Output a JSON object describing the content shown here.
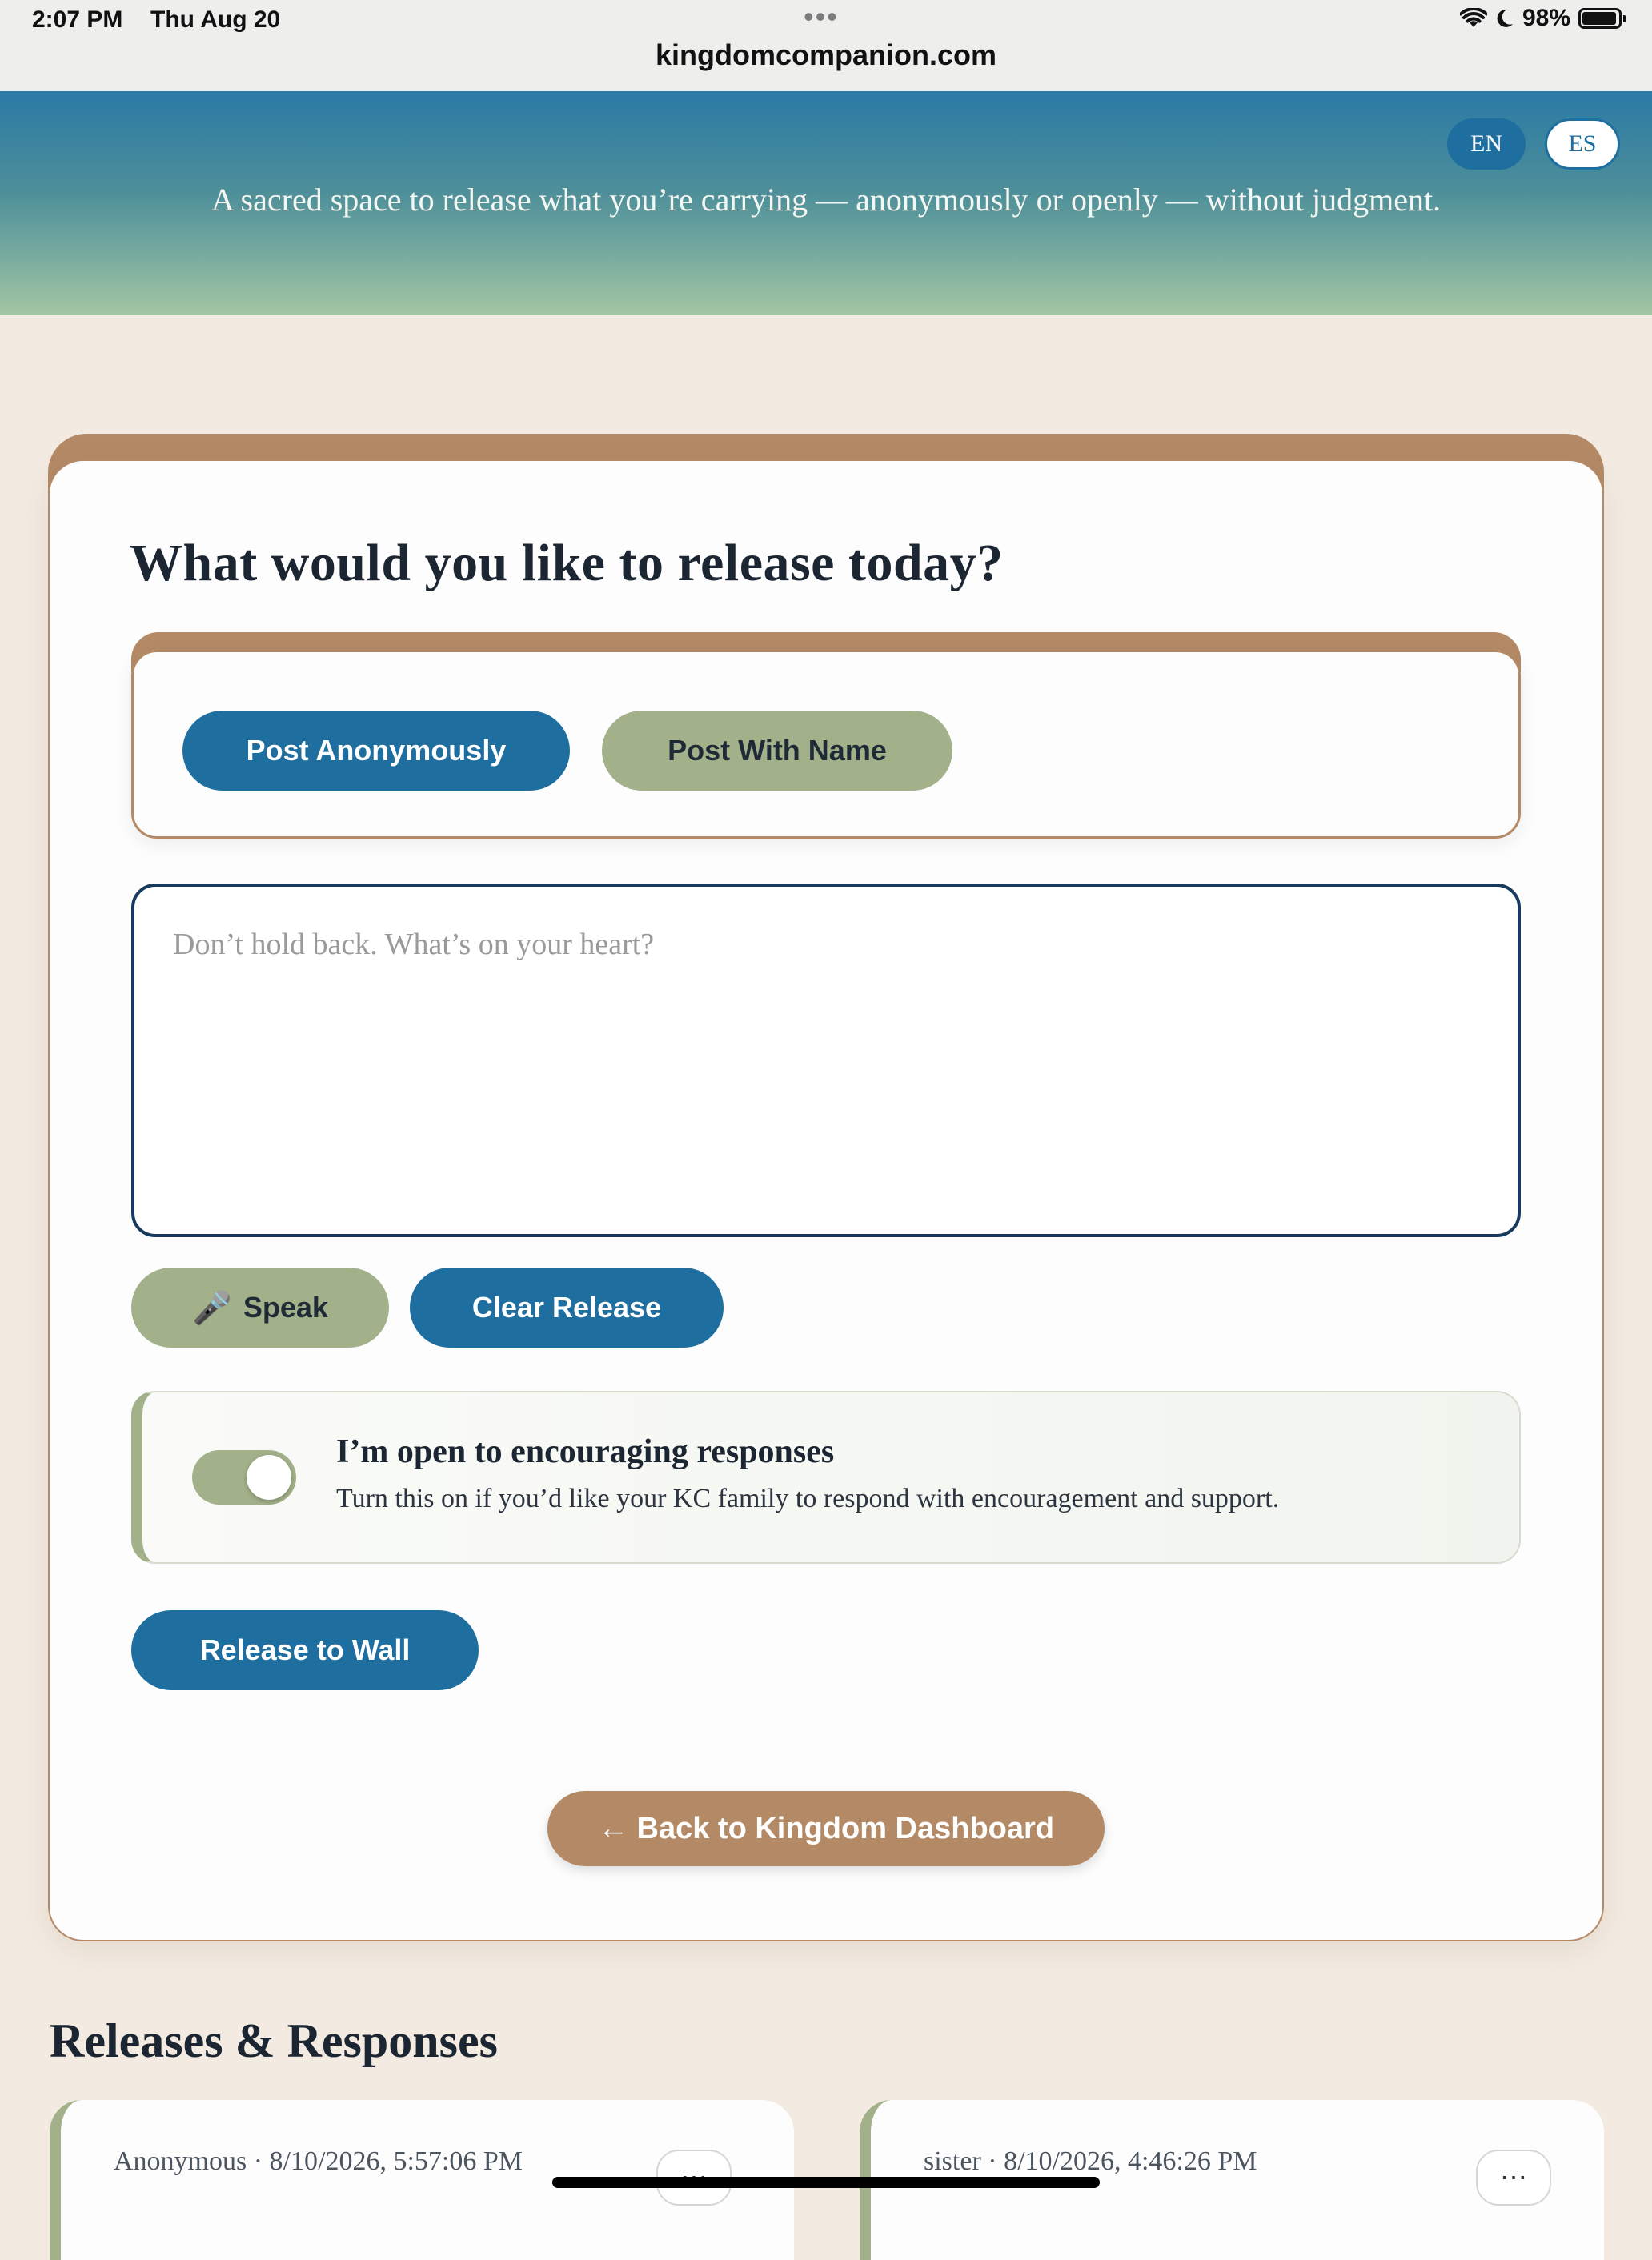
{
  "status_bar": {
    "time": "2:07 PM",
    "date": "Thu Aug 20",
    "dots": "•••",
    "url": "kingdomcompanion.com",
    "battery": "98%",
    "wifi_icon": "wifi-icon",
    "moon_icon": "moon-icon",
    "battery_icon": "battery-icon"
  },
  "hero": {
    "subtitle": "A sacred space to release what you’re carrying — anonymously or openly — without judgment.",
    "languages": [
      "EN",
      "ES"
    ],
    "active_language": "EN"
  },
  "release_form": {
    "title": "What would you like to release today?",
    "post_anonymously_label": "Post Anonymously",
    "post_with_name_label": "Post With Name",
    "textarea_placeholder": "Don’t hold back. What’s on your heart?",
    "textarea_value": "",
    "speak_label": "Speak",
    "speak_icon": "🎤",
    "clear_label": "Clear Release",
    "toggle_title": "I’m open to encouraging responses",
    "toggle_description": "Turn this on if you’d like your KC family to respond with encouragement and support.",
    "toggle_on": true,
    "release_label": "Release to Wall",
    "back_label": "← Back to Kingdom Dashboard"
  },
  "releases": {
    "heading": "Releases & Responses",
    "items": [
      {
        "meta": "Anonymous · 8/10/2026, 5:57:06 PM",
        "menu": "⋯"
      },
      {
        "meta": "sister · 8/10/2026, 4:46:26 PM",
        "menu": "⋯"
      }
    ]
  },
  "colors": {
    "primary_blue": "#1e6f9f",
    "sage": "#a3b18a",
    "clay": "#b48a66",
    "background": "#f3ebe2",
    "ink": "#1c2632"
  }
}
